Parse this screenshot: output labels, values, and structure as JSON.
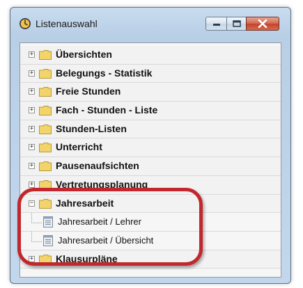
{
  "window": {
    "title": "Listenauswahl",
    "icon": "globe-clock-icon"
  },
  "controls": {
    "minimize_icon": "minimize-icon",
    "maximize_icon": "maximize-icon",
    "close_icon": "close-icon"
  },
  "tree": {
    "categories": [
      {
        "label": "Übersichten",
        "expanded": false
      },
      {
        "label": "Belegungs - Statistik",
        "expanded": false
      },
      {
        "label": "Freie Stunden",
        "expanded": false
      },
      {
        "label": "Fach - Stunden - Liste",
        "expanded": false
      },
      {
        "label": "Stunden-Listen",
        "expanded": false
      },
      {
        "label": "Unterricht",
        "expanded": false
      },
      {
        "label": "Pausenaufsichten",
        "expanded": false
      },
      {
        "label": "Vertretungsplanung",
        "expanded": false
      },
      {
        "label": "Jahresarbeit",
        "expanded": true,
        "children": [
          {
            "label": "Jahresarbeit / Lehrer"
          },
          {
            "label": "Jahresarbeit / Übersicht"
          }
        ]
      },
      {
        "label": "Klausurpläne",
        "expanded": false
      }
    ]
  },
  "colors": {
    "highlight": "#c1272d",
    "folder": "#f3d46a",
    "close_button": "#c2432a"
  }
}
